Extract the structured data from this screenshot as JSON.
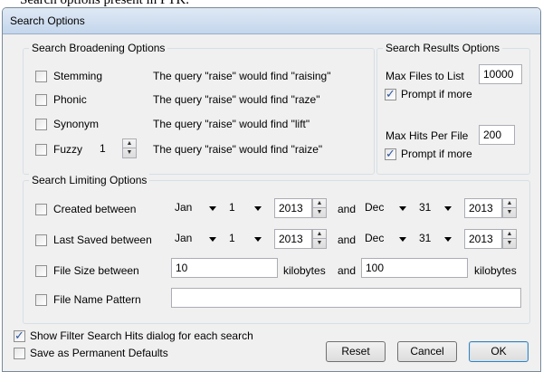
{
  "caption": "Search options present in PTK.",
  "window": {
    "title": "Search Options"
  },
  "broadening": {
    "legend": "Search Broadening Options",
    "items": [
      {
        "label": "Stemming",
        "desc": "The query \"raise\" would find \"raising\"",
        "checked": false
      },
      {
        "label": "Phonic",
        "desc": "The query \"raise\" would find \"raze\"",
        "checked": false
      },
      {
        "label": "Synonym",
        "desc": "The query \"raise\" would find \"lift\"",
        "checked": false
      },
      {
        "label": "Fuzzy",
        "desc": "The query \"raise\" would find \"raize\"",
        "checked": false
      }
    ],
    "fuzzy_value": "1"
  },
  "results": {
    "legend": "Search Results Options",
    "max_files_label": "Max Files to List",
    "max_files_value": "10000",
    "prompt1_label": "Prompt if more",
    "prompt1_checked": true,
    "max_hits_label": "Max Hits Per File",
    "max_hits_value": "200",
    "prompt2_label": "Prompt if more",
    "prompt2_checked": true
  },
  "limiting": {
    "legend": "Search Limiting Options",
    "and_label": "and",
    "created": {
      "label": "Created between",
      "checked": false,
      "from": {
        "month": "Jan",
        "day": "1",
        "year": "2013"
      },
      "to": {
        "month": "Dec",
        "day": "31",
        "year": "2013"
      }
    },
    "saved": {
      "label": "Last Saved between",
      "checked": false,
      "from": {
        "month": "Jan",
        "day": "1",
        "year": "2013"
      },
      "to": {
        "month": "Dec",
        "day": "31",
        "year": "2013"
      }
    },
    "size": {
      "label": "File Size between",
      "checked": false,
      "min": "10",
      "max": "100",
      "unit_label": "kilobytes"
    },
    "pattern": {
      "label": "File Name Pattern",
      "checked": false,
      "value": ""
    }
  },
  "footer": {
    "show_filter_label": "Show Filter Search Hits dialog for each search",
    "show_filter_checked": true,
    "save_defaults_label": "Save as Permanent Defaults",
    "save_defaults_checked": false,
    "reset_label": "Reset",
    "cancel_label": "Cancel",
    "ok_label": "OK"
  }
}
